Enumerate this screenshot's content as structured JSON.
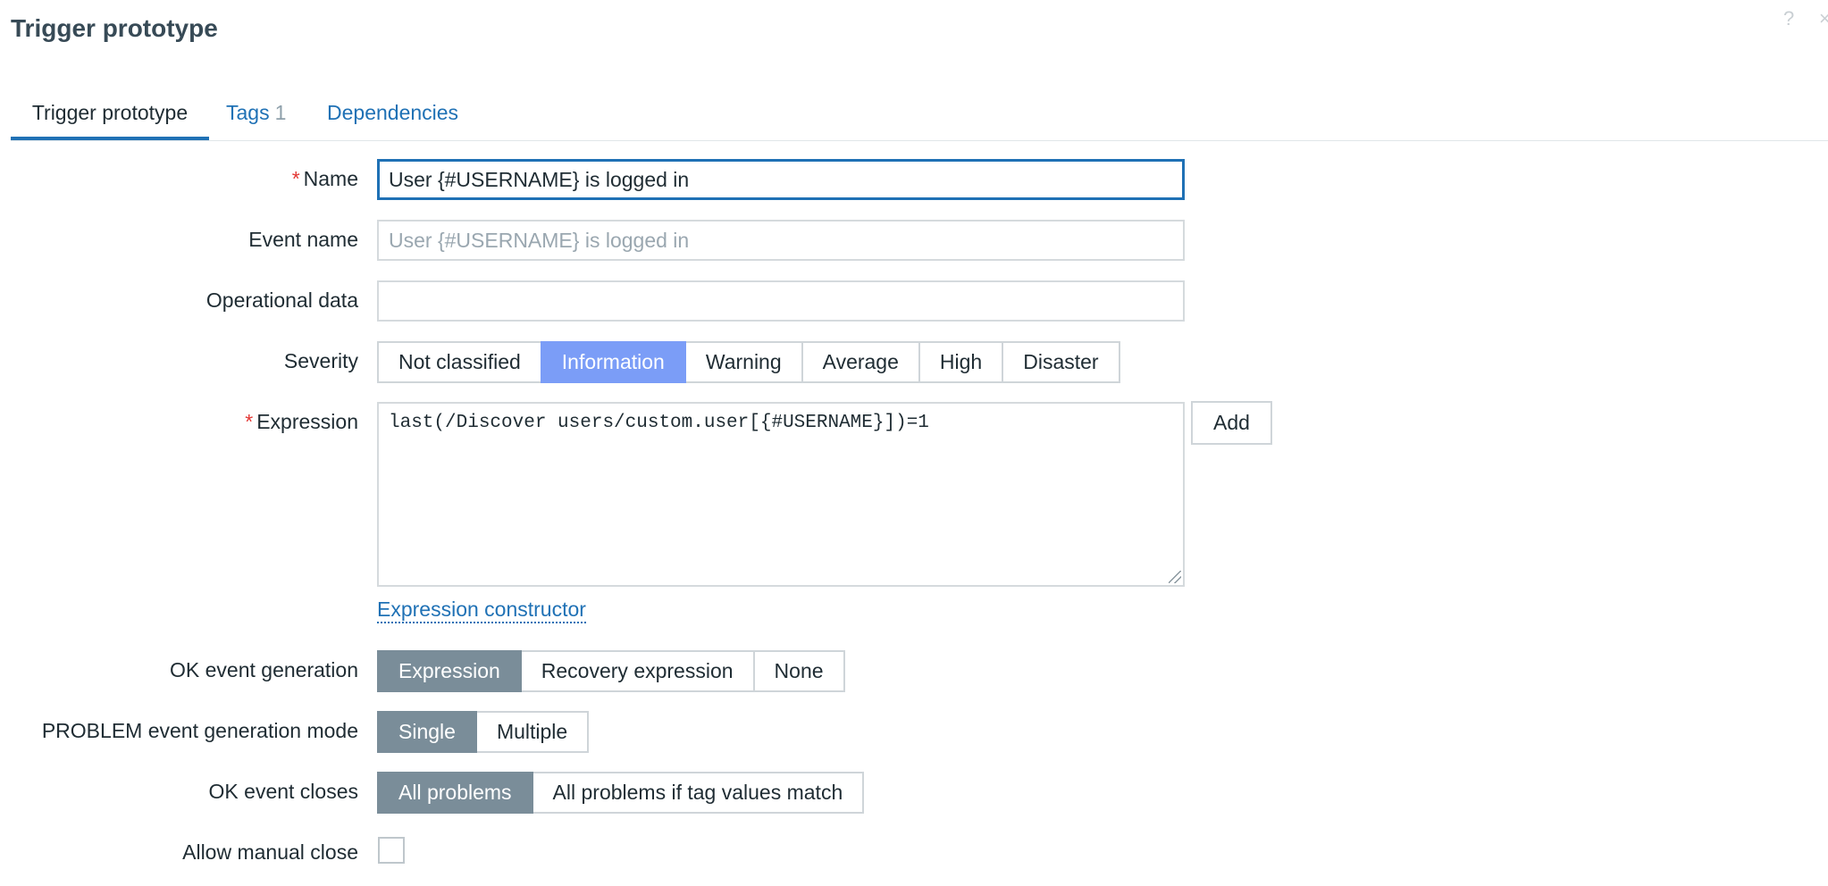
{
  "header": {
    "title": "Trigger prototype",
    "help_glyph": "?",
    "close_glyph": "×"
  },
  "tabs": [
    {
      "label": "Trigger prototype",
      "active": true
    },
    {
      "label": "Tags",
      "count": "1"
    },
    {
      "label": "Dependencies"
    }
  ],
  "form": {
    "name": {
      "label": "Name",
      "required": true,
      "value": "User {#USERNAME} is logged in"
    },
    "event_name": {
      "label": "Event name",
      "value": "",
      "placeholder": "User {#USERNAME} is logged in"
    },
    "operational_data": {
      "label": "Operational data",
      "value": ""
    },
    "severity": {
      "label": "Severity",
      "options": [
        "Not classified",
        "Information",
        "Warning",
        "Average",
        "High",
        "Disaster"
      ],
      "selected": "Information"
    },
    "expression": {
      "label": "Expression",
      "required": true,
      "value": "last(/Discover users/custom.user[{#USERNAME}])=1",
      "add_label": "Add",
      "constructor_link": "Expression constructor"
    },
    "ok_event_generation": {
      "label": "OK event generation",
      "options": [
        "Expression",
        "Recovery expression",
        "None"
      ],
      "selected": "Expression"
    },
    "problem_event_mode": {
      "label": "PROBLEM event generation mode",
      "options": [
        "Single",
        "Multiple"
      ],
      "selected": "Single"
    },
    "ok_event_closes": {
      "label": "OK event closes",
      "options": [
        "All problems",
        "All problems if tag values match"
      ],
      "selected": "All problems"
    },
    "allow_manual_close": {
      "label": "Allow manual close",
      "checked": false
    }
  },
  "colors": {
    "link_blue": "#1f71b5",
    "severity_selected": "#7b9df7",
    "option_selected": "#7a8d99",
    "required_star": "#e33734"
  }
}
